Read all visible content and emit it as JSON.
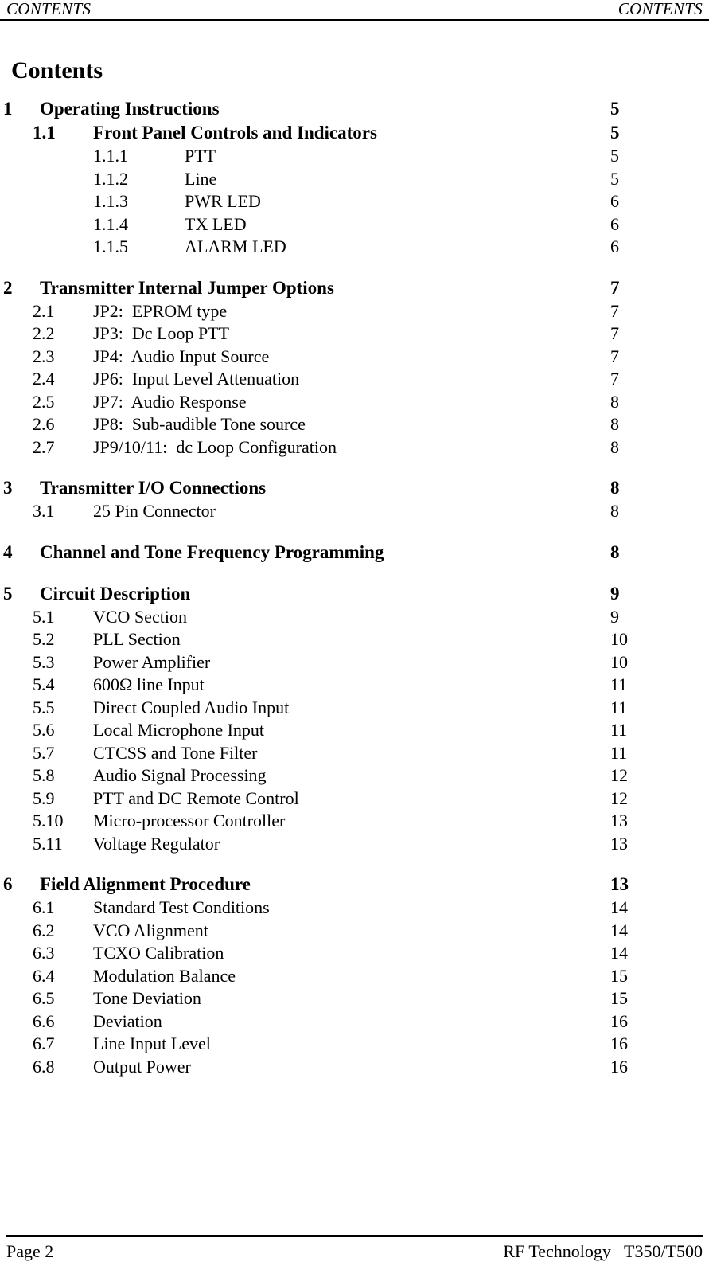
{
  "header": {
    "left": "CONTENTS",
    "right": "CONTENTS"
  },
  "title": "Contents",
  "toc": {
    "groups": [
      {
        "entries": [
          {
            "level": 1,
            "number": "1",
            "label": "Operating Instructions",
            "page": "5"
          },
          {
            "level": 2,
            "number": "1.1",
            "label": "Front Panel Controls and Indicators",
            "page": "5",
            "bold": true
          },
          {
            "level": 3,
            "number": "1.1.1",
            "label": "PTT",
            "page": "5"
          },
          {
            "level": 3,
            "number": "1.1.2",
            "label": "Line",
            "page": "5"
          },
          {
            "level": 3,
            "number": "1.1.3",
            "label": "PWR LED",
            "page": "6"
          },
          {
            "level": 3,
            "number": "1.1.4",
            "label": "TX LED",
            "page": "6"
          },
          {
            "level": 3,
            "number": "1.1.5",
            "label": "ALARM LED",
            "page": "6"
          }
        ]
      },
      {
        "entries": [
          {
            "level": 1,
            "number": "2",
            "label": "Transmitter Internal Jumper Options",
            "page": "7"
          },
          {
            "level": 2,
            "number": "2.1",
            "label": "JP2:  EPROM type",
            "page": "7"
          },
          {
            "level": 2,
            "number": "2.2",
            "label": "JP3:  Dc Loop PTT",
            "page": "7"
          },
          {
            "level": 2,
            "number": "2.3",
            "label": "JP4:  Audio Input Source",
            "page": "7"
          },
          {
            "level": 2,
            "number": "2.4",
            "label": "JP6:  Input Level Attenuation",
            "page": "7"
          },
          {
            "level": 2,
            "number": "2.5",
            "label": "JP7:  Audio Response",
            "page": "8"
          },
          {
            "level": 2,
            "number": "2.6",
            "label": "JP8:  Sub-audible Tone source",
            "page": "8"
          },
          {
            "level": 2,
            "number": "2.7",
            "label": "JP9/10/11:  dc Loop Configuration",
            "page": "8"
          }
        ]
      },
      {
        "entries": [
          {
            "level": 1,
            "number": "3",
            "label": "Transmitter I/O Connections",
            "page": "8"
          },
          {
            "level": 2,
            "number": "3.1",
            "label": "25 Pin Connector",
            "page": "8"
          }
        ]
      },
      {
        "entries": [
          {
            "level": 1,
            "number": "4",
            "label": "Channel and Tone Frequency Programming",
            "page": "8"
          }
        ]
      },
      {
        "entries": [
          {
            "level": 1,
            "number": "5",
            "label": "Circuit Description",
            "page": "9"
          },
          {
            "level": 2,
            "number": "5.1",
            "label": "VCO Section",
            "page": "9"
          },
          {
            "level": 2,
            "number": "5.2",
            "label": "PLL Section",
            "page": "10"
          },
          {
            "level": 2,
            "number": "5.3",
            "label": "Power Amplifier",
            "page": "10"
          },
          {
            "level": 2,
            "number": "5.4",
            "label": "600Ω line Input",
            "page": "11"
          },
          {
            "level": 2,
            "number": "5.5",
            "label": "Direct Coupled Audio Input",
            "page": "11"
          },
          {
            "level": 2,
            "number": "5.6",
            "label": "Local Microphone Input",
            "page": "11"
          },
          {
            "level": 2,
            "number": "5.7",
            "label": "CTCSS and Tone Filter",
            "page": "11"
          },
          {
            "level": 2,
            "number": "5.8",
            "label": "Audio Signal Processing",
            "page": "12"
          },
          {
            "level": 2,
            "number": "5.9",
            "label": "PTT and DC Remote Control",
            "page": "12"
          },
          {
            "level": 2,
            "number": "5.10",
            "label": "Micro-processor Controller",
            "page": "13"
          },
          {
            "level": 2,
            "number": "5.11",
            "label": "Voltage Regulator",
            "page": "13"
          }
        ]
      },
      {
        "entries": [
          {
            "level": 1,
            "number": "6",
            "label": "Field Alignment Procedure",
            "page": "13"
          },
          {
            "level": 2,
            "number": "6.1",
            "label": "Standard Test Conditions",
            "page": "14"
          },
          {
            "level": 2,
            "number": "6.2",
            "label": "VCO Alignment",
            "page": "14"
          },
          {
            "level": 2,
            "number": "6.3",
            "label": "TCXO Calibration",
            "page": "14"
          },
          {
            "level": 2,
            "number": "6.4",
            "label": "Modulation Balance",
            "page": "15"
          },
          {
            "level": 2,
            "number": "6.5",
            "label": "Tone Deviation",
            "page": "15"
          },
          {
            "level": 2,
            "number": "6.6",
            "label": "Deviation",
            "page": "16"
          },
          {
            "level": 2,
            "number": "6.7",
            "label": "Line Input Level",
            "page": "16"
          },
          {
            "level": 2,
            "number": "6.8",
            "label": "Output Power",
            "page": "16"
          }
        ]
      }
    ]
  },
  "footer": {
    "left": "Page 2",
    "right": "RF Technology   T350/T500"
  }
}
